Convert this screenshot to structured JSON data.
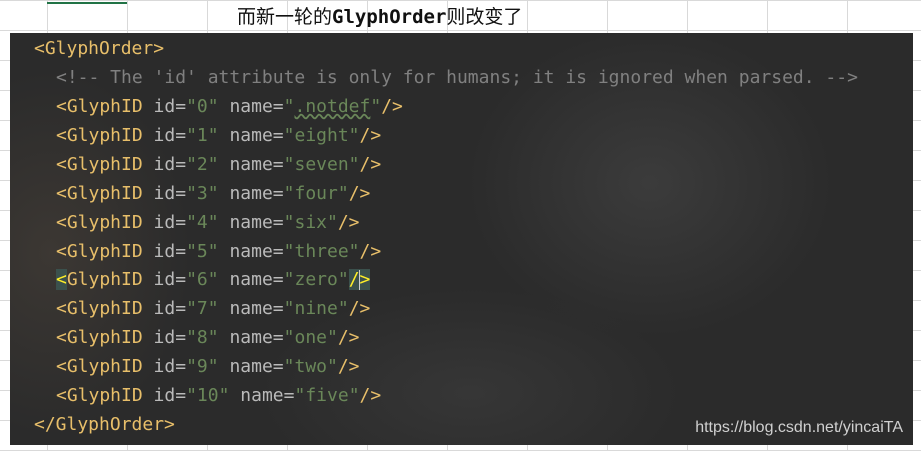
{
  "caption": {
    "prefix": "而新一轮的",
    "code": "GlyphOrder",
    "suffix": "则改变了"
  },
  "editor": {
    "open_tag": "<GlyphOrder>",
    "comment": "<!-- The 'id' attribute is only for humans; it is ignored when parsed. -->",
    "glyphs": [
      {
        "id": "0",
        "name": ".notdef"
      },
      {
        "id": "1",
        "name": "eight"
      },
      {
        "id": "2",
        "name": "seven"
      },
      {
        "id": "3",
        "name": "four"
      },
      {
        "id": "4",
        "name": "six"
      },
      {
        "id": "5",
        "name": "three"
      },
      {
        "id": "6",
        "name": "zero"
      },
      {
        "id": "7",
        "name": "nine"
      },
      {
        "id": "8",
        "name": "one"
      },
      {
        "id": "9",
        "name": "two"
      },
      {
        "id": "10",
        "name": "five"
      }
    ],
    "close_tag": "</GlyphOrder>",
    "highlighted_line_index": 6
  },
  "watermark": "https://blog.csdn.net/yincaiTA",
  "colors": {
    "tag": "#e8bf6a",
    "attr": "#bababa",
    "value": "#6a8759",
    "comment": "#808080",
    "editor_bg": "#2b2b2b"
  }
}
